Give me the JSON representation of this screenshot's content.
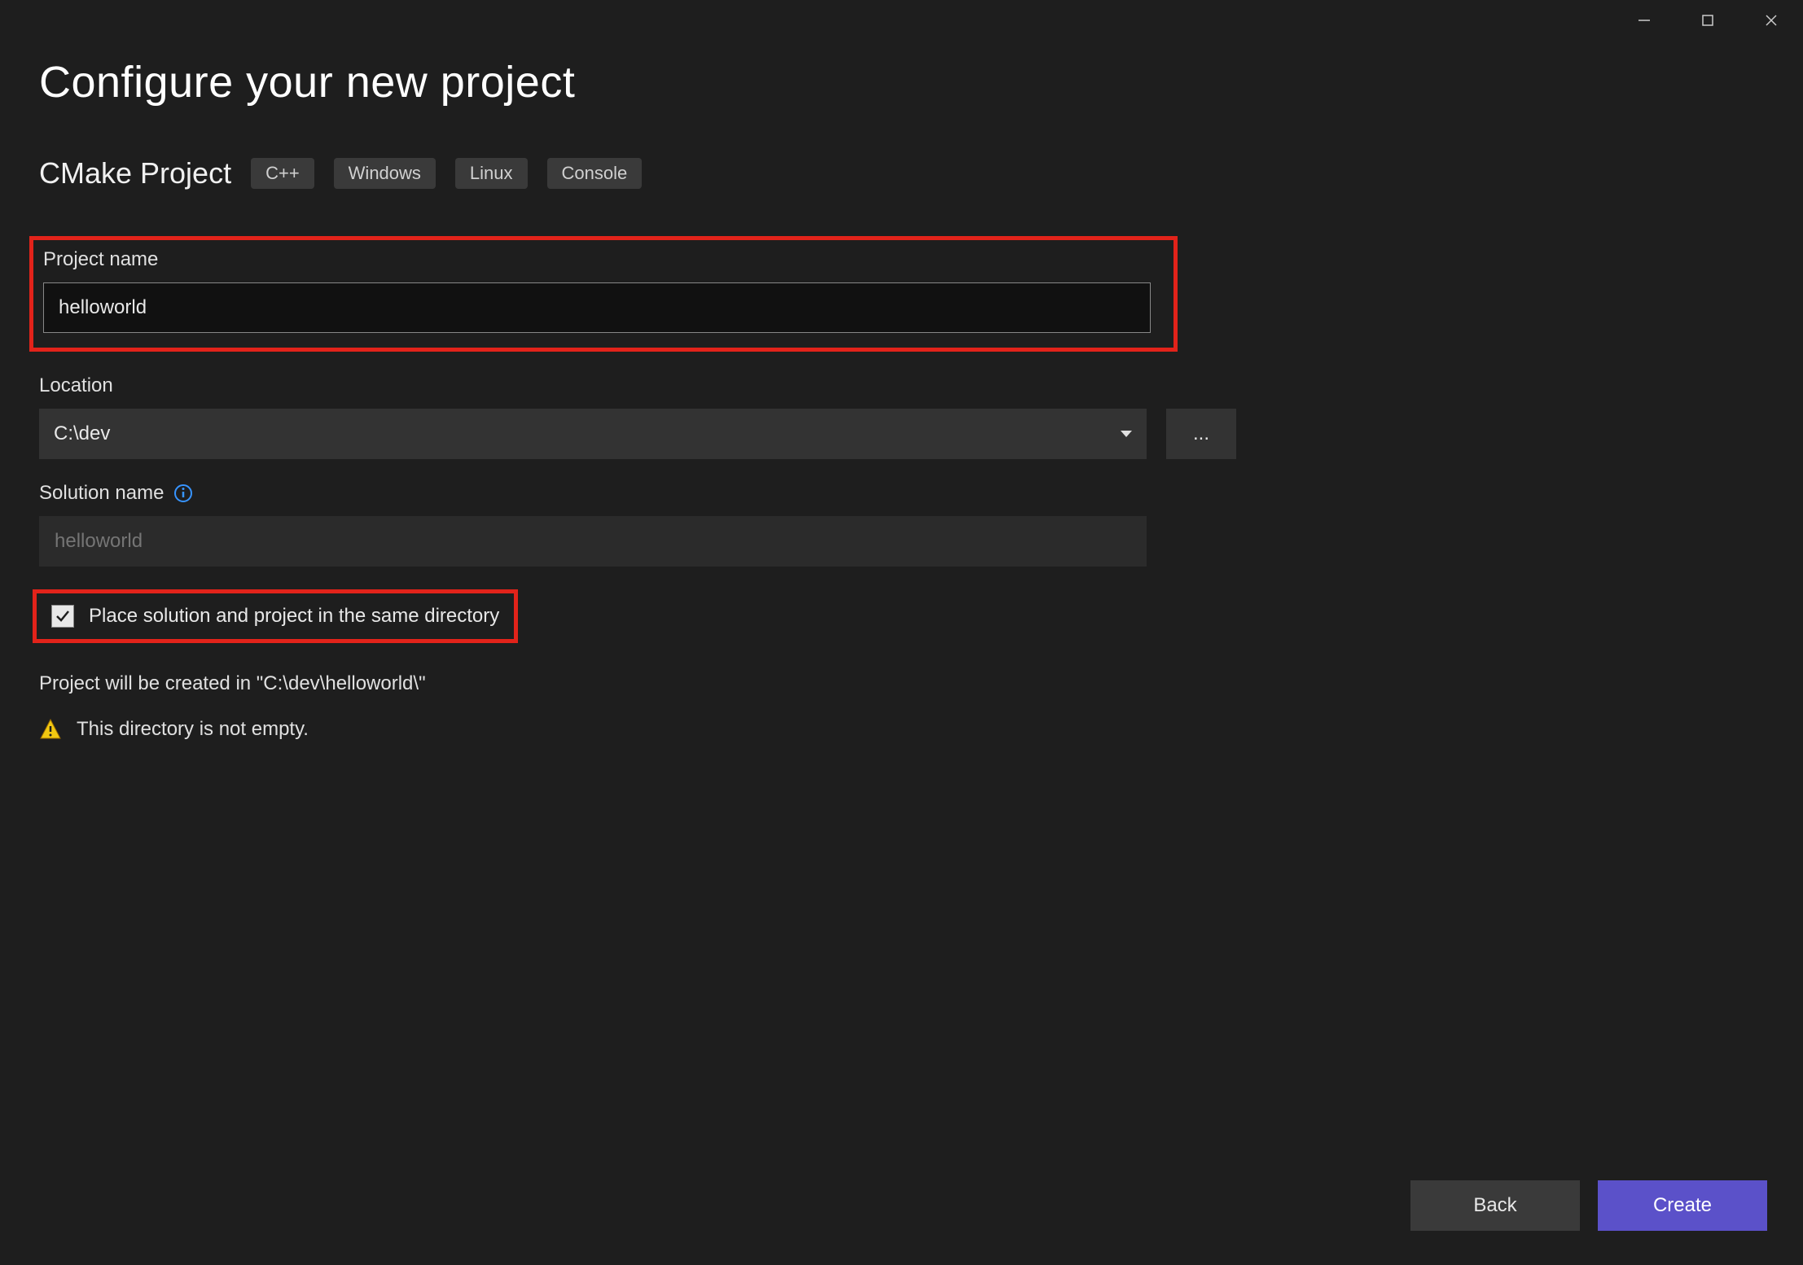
{
  "window": {
    "minimize": "minimize",
    "maximize": "maximize",
    "close": "close"
  },
  "header": {
    "title": "Configure your new project"
  },
  "template": {
    "name": "CMake Project",
    "tags": [
      "C++",
      "Windows",
      "Linux",
      "Console"
    ]
  },
  "fields": {
    "projectName": {
      "label": "Project name",
      "value": "helloworld"
    },
    "location": {
      "label": "Location",
      "value": "C:\\dev",
      "browse": "..."
    },
    "solutionName": {
      "label": "Solution name",
      "placeholder": "helloworld"
    },
    "sameDirectory": {
      "label": "Place solution and project in the same directory",
      "checked": true
    }
  },
  "status": {
    "pathText": "Project will be created in \"C:\\dev\\helloworld\\\"",
    "warningText": "This directory is not empty."
  },
  "footer": {
    "back": "Back",
    "create": "Create"
  }
}
